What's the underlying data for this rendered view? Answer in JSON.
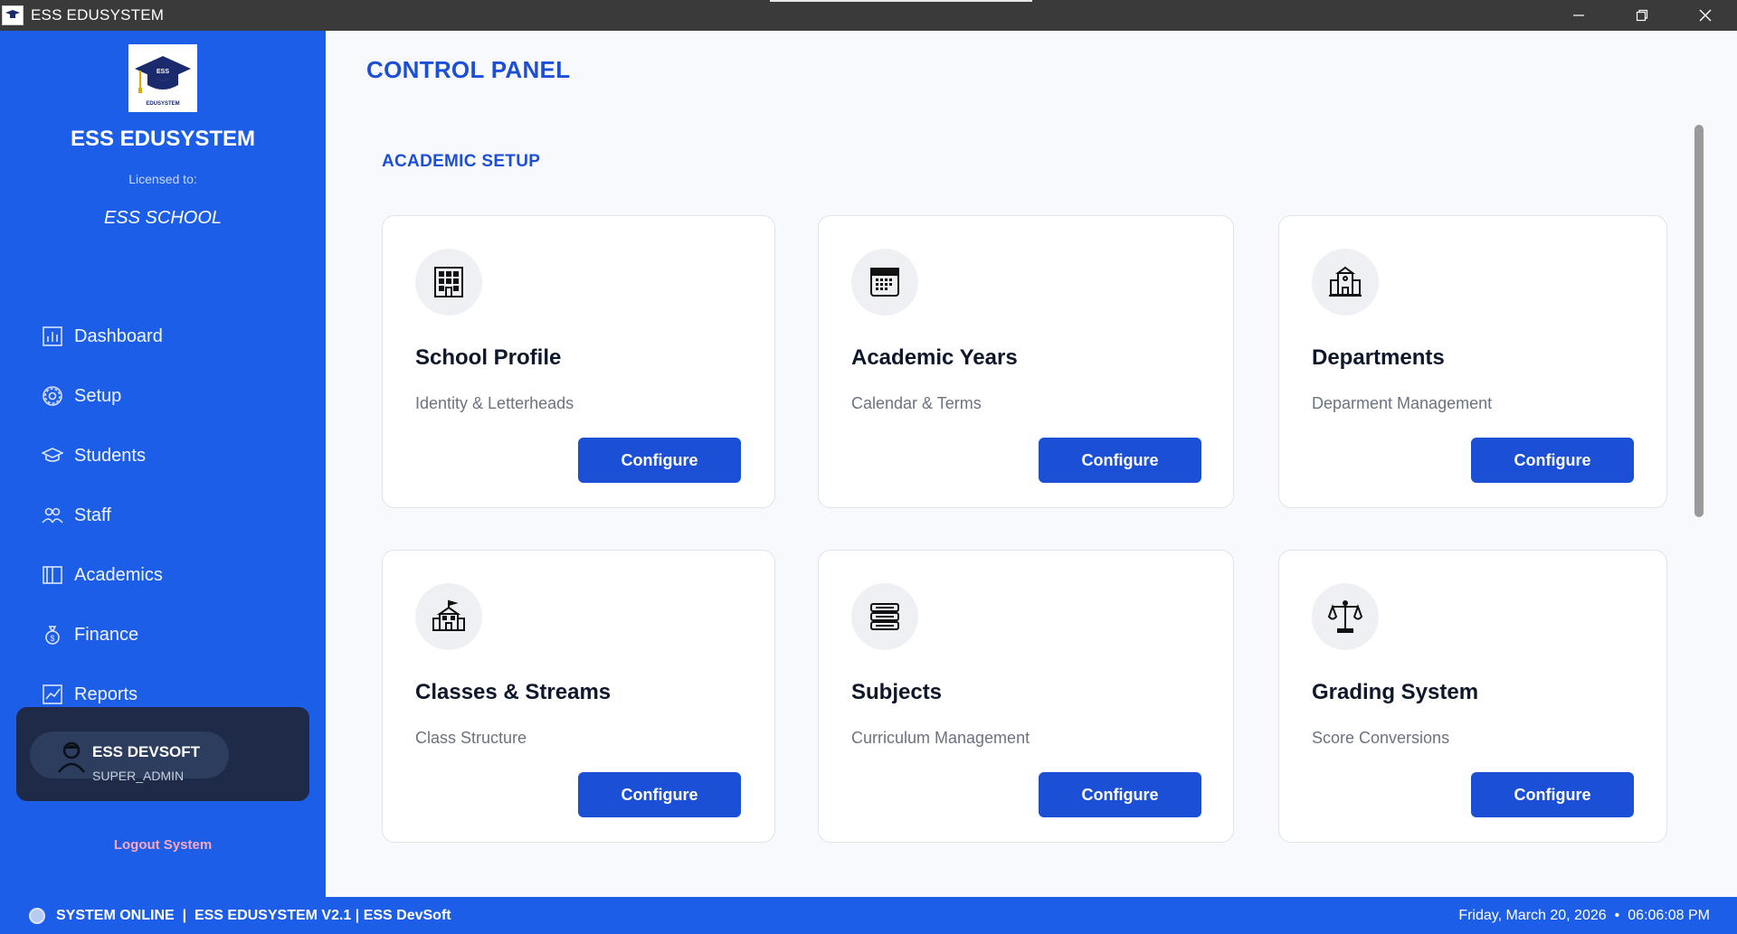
{
  "window": {
    "title": "ESS EDUSYSTEM"
  },
  "sidebar": {
    "brand": "ESS EDUSYSTEM",
    "licensed_label": "Licensed to:",
    "school_name": "ESS SCHOOL",
    "logo_text": "ESS",
    "logo_caption": "EDUSYSTEM",
    "items": [
      {
        "label": "Dashboard",
        "icon": "bar-chart-icon"
      },
      {
        "label": "Setup",
        "icon": "gear-icon"
      },
      {
        "label": "Students",
        "icon": "graduation-cap-icon"
      },
      {
        "label": "Staff",
        "icon": "people-icon"
      },
      {
        "label": "Academics",
        "icon": "book-icon"
      },
      {
        "label": "Finance",
        "icon": "money-bag-icon"
      },
      {
        "label": "Reports",
        "icon": "chart-line-icon"
      }
    ],
    "user": {
      "name": "ESS DEVSOFT",
      "role": "SUPER_ADMIN"
    },
    "logout_label": "Logout System"
  },
  "main": {
    "page_title": "CONTROL PANEL",
    "section_title": "ACADEMIC SETUP",
    "cards": [
      {
        "title": "School Profile",
        "subtitle": "Identity & Letterheads",
        "button": "Configure",
        "icon": "building-icon"
      },
      {
        "title": "Academic Years",
        "subtitle": "Calendar & Terms",
        "button": "Configure",
        "icon": "calendar-icon"
      },
      {
        "title": "Departments",
        "subtitle": "Deparment Management",
        "button": "Configure",
        "icon": "department-building-icon"
      },
      {
        "title": "Classes & Streams",
        "subtitle": "Class Structure",
        "button": "Configure",
        "icon": "school-icon"
      },
      {
        "title": "Subjects",
        "subtitle": "Curriculum Management",
        "button": "Configure",
        "icon": "books-icon"
      },
      {
        "title": "Grading System",
        "subtitle": "Score Conversions",
        "button": "Configure",
        "icon": "scales-icon"
      }
    ]
  },
  "statusbar": {
    "left": "SYSTEM ONLINE  |  ESS EDUSYSTEM V2.1 | ESS DevSoft",
    "date": "Friday, March 20, 2026",
    "separator": "•",
    "time": "06:06:08 PM"
  }
}
